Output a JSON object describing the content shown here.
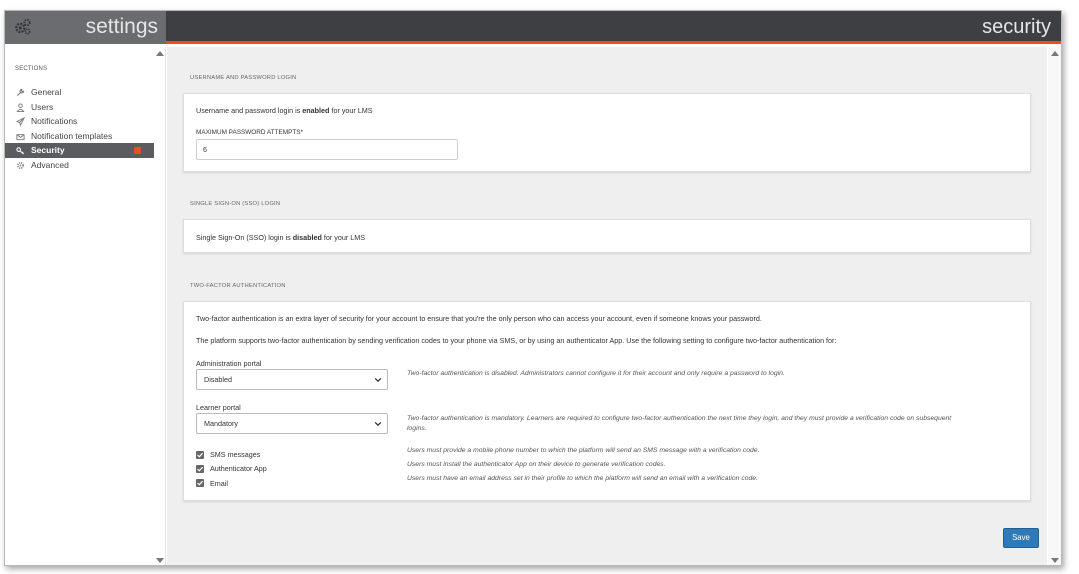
{
  "header": {
    "app_title": "settings",
    "page_title": "security"
  },
  "sidebar": {
    "sections_label": "SECTIONS",
    "items": [
      {
        "label": "General",
        "icon": "wrench-icon"
      },
      {
        "label": "Users",
        "icon": "user-icon"
      },
      {
        "label": "Notifications",
        "icon": "paper-plane-icon"
      },
      {
        "label": "Notification templates",
        "icon": "envelope-icon"
      },
      {
        "label": "Security",
        "icon": "key-icon",
        "active": true
      },
      {
        "label": "Advanced",
        "icon": "gear-icon"
      }
    ]
  },
  "login": {
    "section_label": "USERNAME AND PASSWORD LOGIN",
    "status_prefix": "Username and password login is ",
    "status_value": "enabled",
    "status_suffix": " for your LMS",
    "max_attempts_label": "MAXIMUM PASSWORD ATTEMPTS*",
    "max_attempts_value": "6"
  },
  "sso": {
    "section_label": "SINGLE SIGN-ON (SSO) LOGIN",
    "status_prefix": "Single Sign-On (SSO) login is ",
    "status_value": "disabled",
    "status_suffix": " for your LMS"
  },
  "tfa": {
    "section_label": "TWO-FACTOR AUTHENTICATION",
    "intro_1": "Two-factor authentication is an extra layer of security for your account to ensure that you're the only person who can access your account, even if someone knows your password.",
    "intro_2": "The platform supports two-factor authentication by sending verification codes to your phone via SMS, or by using an authenticator App. Use the following setting to configure two-factor authentication for:",
    "admin_label": "Administration portal",
    "admin_value": "Disabled",
    "admin_hint": "Two-factor authentication is disabled. Administrators cannot configure it for their account and only require a password to login.",
    "learner_label": "Learner portal",
    "learner_value": "Mandatory",
    "learner_hint_1": "Two-factor authentication is mandatory. Learners are required to configure two-factor authentication the next time they login, and they must provide a verification code on subsequent",
    "learner_hint_2": "logins.",
    "methods": [
      {
        "label": "SMS messages",
        "checked": true,
        "hint": "Users must provide a mobile phone number to which the platform will send an SMS message with a verification code."
      },
      {
        "label": "Authenticator App",
        "checked": true,
        "hint": "Users must install the authenticator App on their device to generate verification codes."
      },
      {
        "label": "Email",
        "checked": true,
        "hint": "Users must have an email address set in their profile to which the platform will send an email with a verification code."
      }
    ]
  },
  "footer": {
    "save_label": "Save"
  },
  "colors": {
    "accent": "#e8501f",
    "topbar": "#3d3f42",
    "primary_button": "#2e7ab8"
  }
}
